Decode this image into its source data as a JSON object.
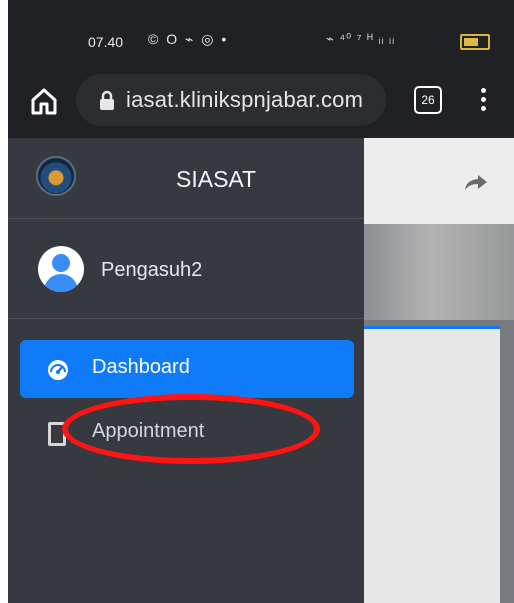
{
  "status_bar": {
    "time": "07.40",
    "icons_left": "© O ⌁ ◎ •",
    "icons_right": "⌁ ⁴⁰ ⁷ ᴴ ᵢᵢ ᵢᵢ"
  },
  "browser": {
    "url": "iasat.klinikspnjabar.com",
    "tab_count": "26"
  },
  "drawer": {
    "brand": "SIASAT",
    "user": "Pengasuh2",
    "nav": [
      {
        "label": "Dashboard"
      },
      {
        "label": "Appointment"
      }
    ]
  },
  "colors": {
    "active": "#0f7bf8",
    "annotation": "#ff1313"
  },
  "icons": {
    "home": "home-icon",
    "lock": "lock-icon",
    "tabs": "tabs-icon",
    "menu": "more-vert-icon",
    "share": "share-icon",
    "dashboard": "speedometer-icon",
    "appointment": "document-icon"
  }
}
